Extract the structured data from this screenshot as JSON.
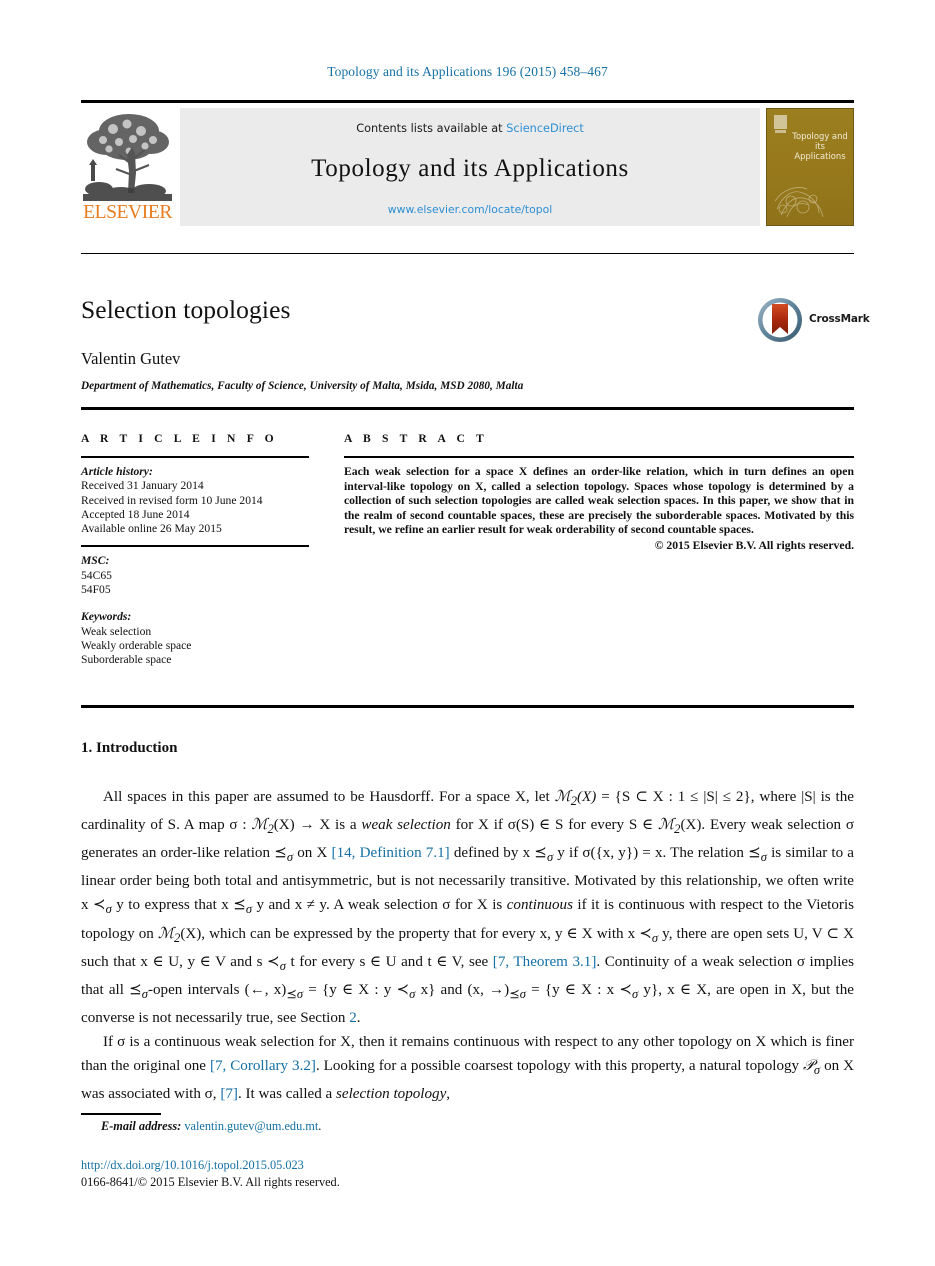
{
  "running_head": "Topology and its Applications 196 (2015) 458–467",
  "masthead": {
    "contents_prefix": "Contents lists available at ",
    "contents_link": "ScienceDirect",
    "journal_title": "Topology and its Applications",
    "journal_url": "www.elsevier.com/locate/topol",
    "publisher_word": "ELSEVIER",
    "cover_title": "Topology and its Applications"
  },
  "article": {
    "title": "Selection topologies",
    "author": "Valentin Gutev",
    "affiliation": "Department of Mathematics, Faculty of Science, University of Malta, Msida, MSD 2080, Malta",
    "crossmark_label": "CrossMark"
  },
  "info": {
    "heading": "A R T I C L E   I N F O",
    "history_label": "Article history:",
    "history": [
      "Received 31 January 2014",
      "Received in revised form 10 June 2014",
      "Accepted 18 June 2014",
      "Available online 26 May 2015"
    ],
    "msc_label": "MSC:",
    "msc": [
      "54C65",
      "54F05"
    ],
    "keywords_label": "Keywords:",
    "keywords": [
      "Weak selection",
      "Weakly orderable space",
      "Suborderable space"
    ]
  },
  "abstract": {
    "heading": "A B S T R A C T",
    "text": "Each weak selection for a space X defines an order-like relation, which in turn defines an open interval-like topology on X, called a selection topology. Spaces whose topology is determined by a collection of such selection topologies are called weak selection spaces. In this paper, we show that in the realm of second countable spaces, these are precisely the suborderable spaces. Motivated by this result, we refine an earlier result for weak orderability of second countable spaces.",
    "copyright": "© 2015 Elsevier B.V. All rights reserved."
  },
  "section": {
    "number_title": "1.  Introduction"
  },
  "body": {
    "paragraph_1_a": "All spaces in this paper are assumed to be Hausdorff. For a space X, let ",
    "paragraph_1_b": " = {S ⊂ X : 1 ≤ |S| ≤ 2}, where |S| is the cardinality of S. A map σ : ",
    "paragraph_1_c": "(X) → X is a ",
    "paragraph_1_d": "weak selection",
    "paragraph_1_e": " for X if σ(S) ∈ S for every S ∈ ",
    "paragraph_1_f": "(X). Every weak selection σ generates an order-like relation ⪯",
    "paragraph_1_g": " on X ",
    "ref_14": "[14, Definition 7.1]",
    "paragraph_1_h": " defined by x ⪯",
    "paragraph_1_i": " y if σ({x, y}) = x. The relation ⪯",
    "paragraph_1_j": " is similar to a linear order being both total and antisymmetric, but is not necessarily transitive. Motivated by this relationship, we often write x ≺",
    "paragraph_1_k": " y to express that x ⪯",
    "paragraph_1_l": " y and x ≠ y. A weak selection σ for X is ",
    "paragraph_1_m": "continuous",
    "paragraph_1_n": " if it is continuous with respect to the Vietoris topology on ",
    "paragraph_1_o": "(X), which can be expressed by the property that for every x, y ∈ X with x ≺",
    "paragraph_1_p": " y, there are open sets U, V ⊂ X such that x ∈ U, y ∈ V and s ≺",
    "paragraph_1_q": " t for every s ∈ U and t ∈ V, see ",
    "ref_7_thm": "[7, Theorem 3.1]",
    "paragraph_1_r": ". Continuity of a weak selection σ implies that all ⪯",
    "paragraph_1_s": "-open intervals (←, x)",
    "paragraph_1_t": " = {y ∈ X : y ≺",
    "paragraph_1_u": " x} and (x, →)",
    "paragraph_1_v": " = {y ∈ X : x ≺",
    "paragraph_1_w": " y}, x ∈ X, are open in X, but the converse is not necessarily true, see Section ",
    "ref_sec2": "2",
    "paragraph_1_x": ".",
    "paragraph_2_a": "If σ is a continuous weak selection for X, then it remains continuous with respect to any other topology on X which is finer than the original one ",
    "ref_7_cor": "[7, Corollary 3.2]",
    "paragraph_2_b": ". Looking for a possible coarsest topology with this property, a natural topology ",
    "paragraph_2_c": " on X was associated with σ, ",
    "ref_7": "[7]",
    "paragraph_2_d": ". It was called a ",
    "paragraph_2_e": "selection topology",
    "paragraph_2_f": ","
  },
  "footer": {
    "email_label": "E-mail address:",
    "email": "valentin.gutev@um.edu.mt",
    "email_period": ".",
    "doi": "http://dx.doi.org/10.1016/j.topol.2015.05.023",
    "issn_line": "0166-8641/© 2015 Elsevier B.V. All rights reserved."
  },
  "colors": {
    "link": "#1470a5",
    "sciencedirect": "#2b8fd4",
    "elsevier_orange": "#e87c1e",
    "cover_olive": "#9b7f20"
  }
}
